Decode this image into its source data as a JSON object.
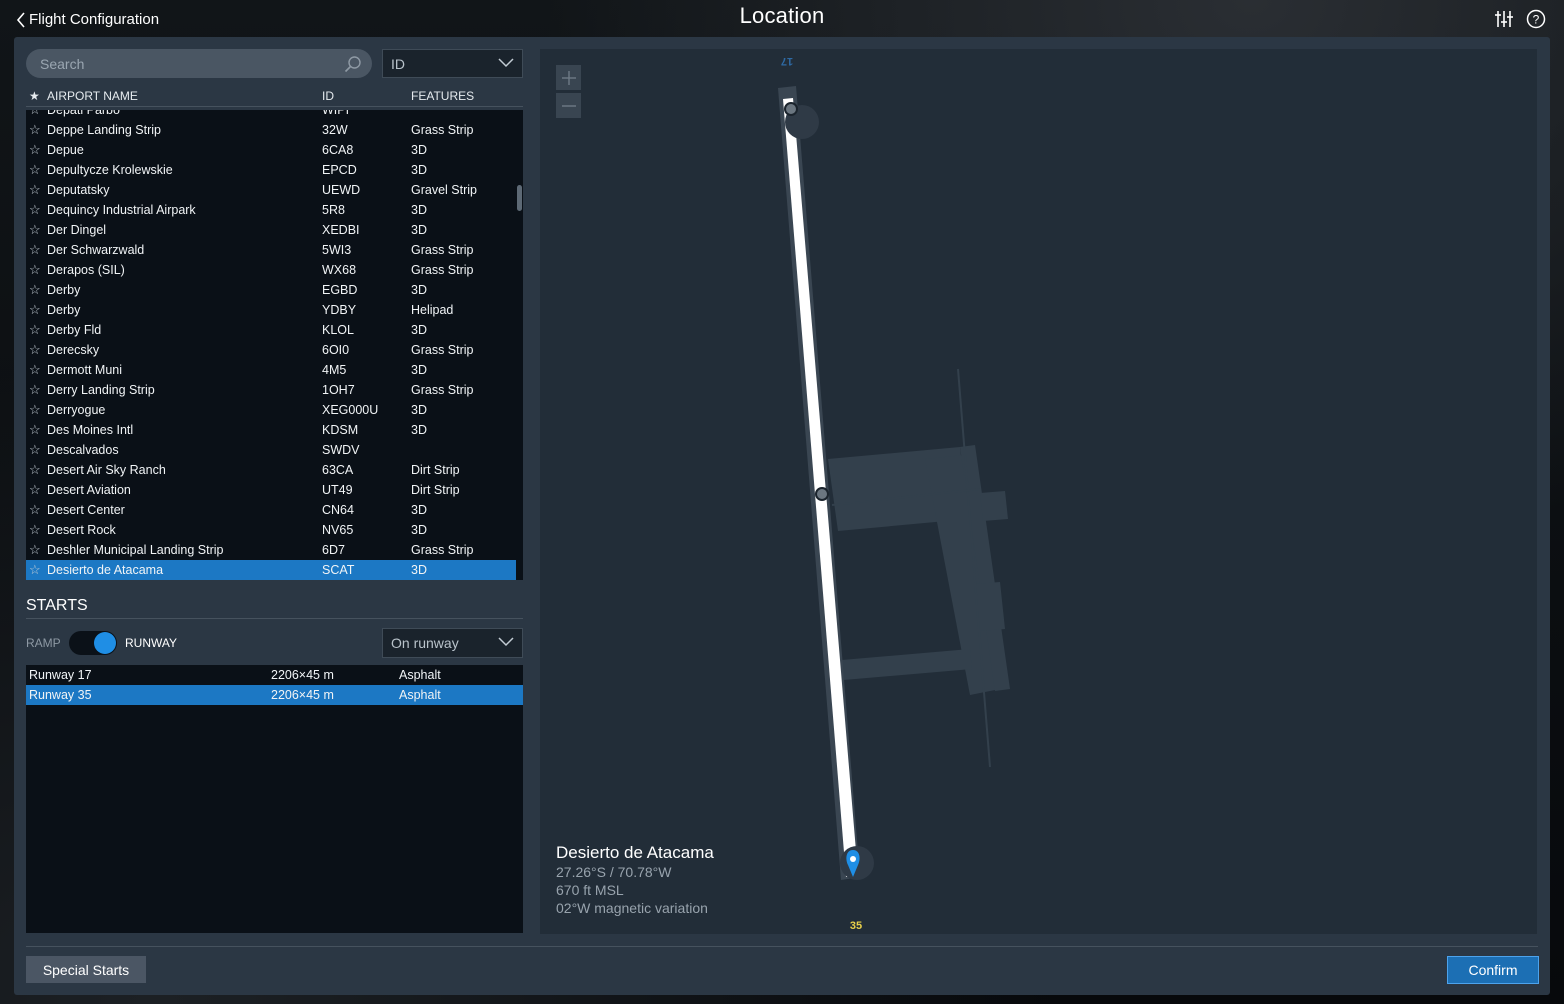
{
  "header": {
    "back_label": "Flight Configuration",
    "title": "Location",
    "icons": [
      "sliders-icon",
      "help-icon"
    ]
  },
  "search": {
    "placeholder": "Search",
    "value": ""
  },
  "filter_select": {
    "value": "ID"
  },
  "airport_table": {
    "columns": [
      "AIRPORT NAME",
      "ID",
      "FEATURES"
    ],
    "partial_row": {
      "name": "Depati Parbo",
      "id": "WIPI",
      "features": ""
    },
    "rows": [
      {
        "name": "Deppe Landing Strip",
        "id": "32W",
        "features": "Grass Strip"
      },
      {
        "name": "Depue",
        "id": "6CA8",
        "features": "3D"
      },
      {
        "name": "Depultycze Krolewskie",
        "id": "EPCD",
        "features": "3D"
      },
      {
        "name": "Deputatsky",
        "id": "UEWD",
        "features": "Gravel Strip"
      },
      {
        "name": "Dequincy Industrial Airpark",
        "id": "5R8",
        "features": "3D"
      },
      {
        "name": "Der Dingel",
        "id": "XEDBI",
        "features": "3D"
      },
      {
        "name": "Der Schwarzwald",
        "id": "5WI3",
        "features": "Grass Strip"
      },
      {
        "name": "Derapos (SIL)",
        "id": "WX68",
        "features": "Grass Strip"
      },
      {
        "name": "Derby",
        "id": "EGBD",
        "features": "3D"
      },
      {
        "name": "Derby",
        "id": "YDBY",
        "features": "Helipad"
      },
      {
        "name": "Derby Fld",
        "id": "KLOL",
        "features": "3D"
      },
      {
        "name": "Derecsky",
        "id": "6OI0",
        "features": "Grass Strip"
      },
      {
        "name": "Dermott Muni",
        "id": "4M5",
        "features": "3D"
      },
      {
        "name": "Derry Landing Strip",
        "id": "1OH7",
        "features": "Grass Strip"
      },
      {
        "name": "Derryogue",
        "id": "XEG000U",
        "features": "3D"
      },
      {
        "name": "Des Moines Intl",
        "id": "KDSM",
        "features": "3D"
      },
      {
        "name": "Descalvados",
        "id": "SWDV",
        "features": ""
      },
      {
        "name": "Desert Air Sky Ranch",
        "id": "63CA",
        "features": "Dirt Strip"
      },
      {
        "name": "Desert Aviation",
        "id": "UT49",
        "features": "Dirt Strip"
      },
      {
        "name": "Desert Center",
        "id": "CN64",
        "features": "3D"
      },
      {
        "name": "Desert Rock",
        "id": "NV65",
        "features": "3D"
      },
      {
        "name": "Deshler Municipal Landing Strip",
        "id": "6D7",
        "features": "Grass Strip"
      },
      {
        "name": "Desierto de Atacama",
        "id": "SCAT",
        "features": "3D"
      }
    ],
    "selected_index": 22
  },
  "starts": {
    "heading": "STARTS",
    "toggle_left": "RAMP",
    "toggle_right": "RUNWAY",
    "toggle_state": "RUNWAY",
    "start_select": "On runway",
    "runways": [
      {
        "name": "Runway 17",
        "size": "2206×45 m",
        "surface": "Asphalt"
      },
      {
        "name": "Runway 35",
        "size": "2206×45 m",
        "surface": "Asphalt"
      }
    ],
    "selected_index": 1
  },
  "map": {
    "airport_name": "Desierto de Atacama",
    "coords": "27.26°S / 70.78°W",
    "elevation": "670 ft MSL",
    "magvar": "02°W magnetic variation",
    "runway_label_top": "17",
    "runway_label_bottom": "35",
    "zoom_in": "+",
    "zoom_out": "−"
  },
  "footer": {
    "special_starts": "Special Starts",
    "confirm": "Confirm"
  },
  "colors": {
    "accent": "#1c78c4",
    "panel": "#2b3744",
    "list_bg": "#0a1017",
    "map_bg": "#222d38",
    "runway_label": "#e8d04a"
  }
}
